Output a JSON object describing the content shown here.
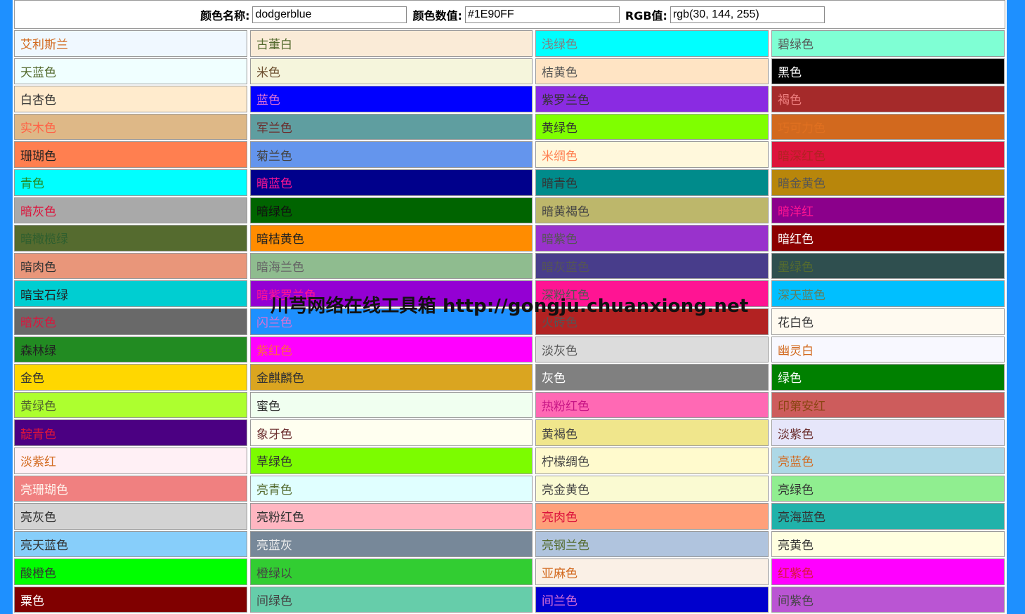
{
  "info": {
    "name_label": "颜色名称:",
    "name_value": "dodgerblue",
    "hex_label": "颜色数值:",
    "hex_value": "#1E90FF",
    "rgb_label": "RGB值:",
    "rgb_value": "rgb(30, 144, 255)"
  },
  "watermark": "川芎网络在线工具箱 http://gongju.chuanxiong.net",
  "colors": [
    {
      "label": "艾利斯兰",
      "bg": "#F0F8FF",
      "fg": "#D2691E"
    },
    {
      "label": "古董白",
      "bg": "#FAEBD7",
      "fg": "#556B2F"
    },
    {
      "label": "浅绿色",
      "bg": "#00FFFF",
      "fg": "#808080"
    },
    {
      "label": "碧绿色",
      "bg": "#7FFFD4",
      "fg": "#555555"
    },
    {
      "label": "天蓝色",
      "bg": "#F0FFFF",
      "fg": "#556B2F"
    },
    {
      "label": "米色",
      "bg": "#F5F5DC",
      "fg": "#6B4E2E"
    },
    {
      "label": "桔黄色",
      "bg": "#FFE4C4",
      "fg": "#555555"
    },
    {
      "label": "黑色",
      "bg": "#000000",
      "fg": "#FFFFFF"
    },
    {
      "label": "白杏色",
      "bg": "#FFEBCD",
      "fg": "#333333"
    },
    {
      "label": "蓝色",
      "bg": "#0000FF",
      "fg": "#DA70D6"
    },
    {
      "label": "紫罗兰色",
      "bg": "#8A2BE2",
      "fg": "#333333"
    },
    {
      "label": "褐色",
      "bg": "#A52A2A",
      "fg": "#F08080"
    },
    {
      "label": "实木色",
      "bg": "#DEB887",
      "fg": "#FF6347"
    },
    {
      "label": "军兰色",
      "bg": "#5F9EA0",
      "fg": "#6B2E2E"
    },
    {
      "label": "黄绿色",
      "bg": "#7FFF00",
      "fg": "#333333"
    },
    {
      "label": "巧可力色",
      "bg": "#D2691E",
      "fg": "#E07020"
    },
    {
      "label": "珊瑚色",
      "bg": "#FF7F50",
      "fg": "#222222"
    },
    {
      "label": "菊兰色",
      "bg": "#6495ED",
      "fg": "#444444"
    },
    {
      "label": "米绸色",
      "bg": "#FFF8DC",
      "fg": "#FF7F50"
    },
    {
      "label": "暗深红色",
      "bg": "#DC143C",
      "fg": "#B22222"
    },
    {
      "label": "青色",
      "bg": "#00FFFF",
      "fg": "#228B22"
    },
    {
      "label": "暗蓝色",
      "bg": "#00008B",
      "fg": "#FF1493"
    },
    {
      "label": "暗青色",
      "bg": "#008B8B",
      "fg": "#333333"
    },
    {
      "label": "暗金黄色",
      "bg": "#B8860B",
      "fg": "#555555"
    },
    {
      "label": "暗灰色",
      "bg": "#A9A9A9",
      "fg": "#DC143C"
    },
    {
      "label": "暗绿色",
      "bg": "#006400",
      "fg": "#111111"
    },
    {
      "label": "暗黄褐色",
      "bg": "#BDB76B",
      "fg": "#444444"
    },
    {
      "label": "暗洋红",
      "bg": "#8B008B",
      "fg": "#FF1493"
    },
    {
      "label": "暗橄榄绿",
      "bg": "#556B2F",
      "fg": "#2E5E2E"
    },
    {
      "label": "暗桔黄色",
      "bg": "#FF8C00",
      "fg": "#222222"
    },
    {
      "label": "暗紫色",
      "bg": "#9932CC",
      "fg": "#555555"
    },
    {
      "label": "暗红色",
      "bg": "#8B0000",
      "fg": "#FFFFFF"
    },
    {
      "label": "暗肉色",
      "bg": "#E9967A",
      "fg": "#333333"
    },
    {
      "label": "暗海兰色",
      "bg": "#8FBC8F",
      "fg": "#666666"
    },
    {
      "label": "暗灰蓝色",
      "bg": "#483D8B",
      "fg": "#555555"
    },
    {
      "label": "墨绿色",
      "bg": "#2F4F4F",
      "fg": "#556B2F"
    },
    {
      "label": "暗宝石绿",
      "bg": "#00CED1",
      "fg": "#222222"
    },
    {
      "label": "暗紫罗兰色",
      "bg": "#9400D3",
      "fg": "#FF1493"
    },
    {
      "label": "深粉红色",
      "bg": "#FF1493",
      "fg": "#555555"
    },
    {
      "label": "深天蓝色",
      "bg": "#00BFFF",
      "fg": "#5F7F5F"
    },
    {
      "label": "暗灰色",
      "bg": "#696969",
      "fg": "#DC143C"
    },
    {
      "label": "闪兰色",
      "bg": "#1E90FF",
      "fg": "#DA70D6"
    },
    {
      "label": "火砖色",
      "bg": "#B22222",
      "fg": "#555555"
    },
    {
      "label": "花白色",
      "bg": "#FFFAF0",
      "fg": "#333333"
    },
    {
      "label": "森林绿",
      "bg": "#228B22",
      "fg": "#222222"
    },
    {
      "label": "紫红色",
      "bg": "#FF00FF",
      "fg": "#FF6347"
    },
    {
      "label": "淡灰色",
      "bg": "#DCDCDC",
      "fg": "#555555"
    },
    {
      "label": "幽灵白",
      "bg": "#F8F8FF",
      "fg": "#D2691E"
    },
    {
      "label": "金色",
      "bg": "#FFD700",
      "fg": "#333333"
    },
    {
      "label": "金麒麟色",
      "bg": "#DAA520",
      "fg": "#333333"
    },
    {
      "label": "灰色",
      "bg": "#808080",
      "fg": "#FFFFFF"
    },
    {
      "label": "绿色",
      "bg": "#008000",
      "fg": "#FFFFFF"
    },
    {
      "label": "黄绿色",
      "bg": "#ADFF2F",
      "fg": "#556B2F"
    },
    {
      "label": "蜜色",
      "bg": "#F0FFF0",
      "fg": "#333333"
    },
    {
      "label": "热粉红色",
      "bg": "#FF69B4",
      "fg": "#C71585"
    },
    {
      "label": "印第安红",
      "bg": "#CD5C5C",
      "fg": "#8B4513"
    },
    {
      "label": "靛青色",
      "bg": "#4B0082",
      "fg": "#DC143C"
    },
    {
      "label": "象牙色",
      "bg": "#FFFFF0",
      "fg": "#6B2E2E"
    },
    {
      "label": "黄褐色",
      "bg": "#F0E68C",
      "fg": "#444444"
    },
    {
      "label": "淡紫色",
      "bg": "#E6E6FA",
      "fg": "#6B2E2E"
    },
    {
      "label": "淡紫红",
      "bg": "#FFF0F5",
      "fg": "#D2691E"
    },
    {
      "label": "草绿色",
      "bg": "#7CFC00",
      "fg": "#333333"
    },
    {
      "label": "柠檬绸色",
      "bg": "#FFFACD",
      "fg": "#444444"
    },
    {
      "label": "亮蓝色",
      "bg": "#ADD8E6",
      "fg": "#D2691E"
    },
    {
      "label": "亮珊瑚色",
      "bg": "#F08080",
      "fg": "#FFF5EE"
    },
    {
      "label": "亮青色",
      "bg": "#E0FFFF",
      "fg": "#556B2F"
    },
    {
      "label": "亮金黄色",
      "bg": "#FAFAD2",
      "fg": "#444444"
    },
    {
      "label": "亮绿色",
      "bg": "#90EE90",
      "fg": "#333333"
    },
    {
      "label": "亮灰色",
      "bg": "#D3D3D3",
      "fg": "#333333"
    },
    {
      "label": "亮粉红色",
      "bg": "#FFB6C1",
      "fg": "#333333"
    },
    {
      "label": "亮肉色",
      "bg": "#FFA07A",
      "fg": "#DC143C"
    },
    {
      "label": "亮海蓝色",
      "bg": "#20B2AA",
      "fg": "#333333"
    },
    {
      "label": "亮天蓝色",
      "bg": "#87CEFA",
      "fg": "#333333"
    },
    {
      "label": "亮蓝灰",
      "bg": "#778899",
      "fg": "#EEEEEE"
    },
    {
      "label": "亮钢兰色",
      "bg": "#B0C4DE",
      "fg": "#556B2F"
    },
    {
      "label": "亮黄色",
      "bg": "#FFFFE0",
      "fg": "#333333"
    },
    {
      "label": "酸橙色",
      "bg": "#00FF00",
      "fg": "#333333"
    },
    {
      "label": "橙绿以",
      "bg": "#32CD32",
      "fg": "#444444"
    },
    {
      "label": "亚麻色",
      "bg": "#FAF0E6",
      "fg": "#D2691E"
    },
    {
      "label": "红紫色",
      "bg": "#FF00FF",
      "fg": "#DC143C"
    },
    {
      "label": "粟色",
      "bg": "#800000",
      "fg": "#FFFFFF"
    },
    {
      "label": "间绿色",
      "bg": "#66CDAA",
      "fg": "#444444"
    },
    {
      "label": "间兰色",
      "bg": "#0000CD",
      "fg": "#DA70D6"
    },
    {
      "label": "间紫色",
      "bg": "#BA55D3",
      "fg": "#444444"
    }
  ]
}
